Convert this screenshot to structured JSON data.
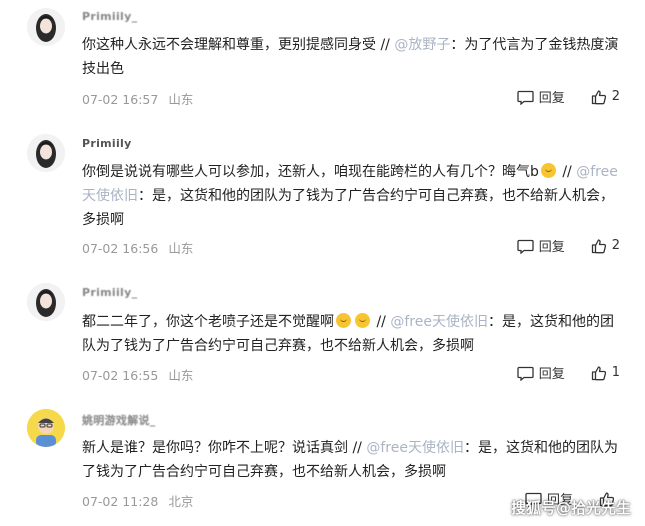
{
  "comments": [
    {
      "username": "Primiily_",
      "text_main": "你这种人永远不会理解和尊重，更别提感同身受 //",
      "mention": "@放野子",
      "text_tail": "：为了代言为了金钱热度演技出色",
      "time": "07-02 16:57",
      "location": "山东",
      "reply_label": "回复",
      "like_count": "2"
    },
    {
      "username": "Primiily",
      "text_main": "你倒是说说有哪些人可以参加，还新人，咱现在能跨栏的人有几个？晦气b",
      "mention": "@free天使依旧",
      "text_tail": "：是，这货和他的团队为了钱为了广告合约宁可自己弃赛，也不给新人机会，多损啊",
      "time": "07-02 16:56",
      "location": "山东",
      "reply_label": "回复",
      "like_count": "2"
    },
    {
      "username": "Primiily_",
      "text_main": "都二二年了，你这个老喷子还是不觉醒啊",
      "mention": "@free天使依旧",
      "text_tail": "：是，这货和他的团队为了钱为了广告合约宁可自己弃赛，也不给新人机会，多损啊",
      "time": "07-02 16:55",
      "location": "山东",
      "reply_label": "回复",
      "like_count": "1"
    },
    {
      "username": "姚明游戏解说_",
      "text_main": "新人是谁？是你吗？你咋不上呢？说话真剑 //",
      "mention": "@free天使依旧",
      "text_tail": "：是，这货和他的团队为了钱为了广告合约宁可自己弃赛，也不给新人机会，多损啊",
      "time": "07-02 11:28",
      "location": "北京",
      "reply_label": "回复",
      "like_count": ""
    }
  ],
  "watermark": "搜狐号@拾光先生",
  "icons": {
    "reply": "comment-bubble-icon",
    "like": "thumbs-up-icon",
    "emoji": "grin-emoji-icon"
  },
  "colors": {
    "meta": "#999999",
    "mention": "#aab4c4",
    "text": "#222222"
  }
}
